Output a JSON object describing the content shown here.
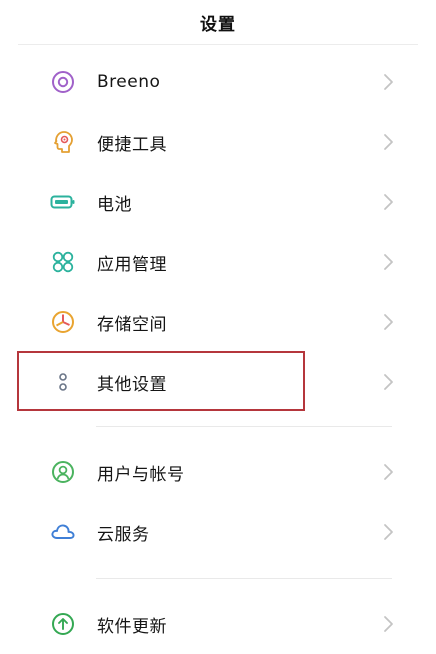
{
  "header": {
    "title": "设置"
  },
  "colors": {
    "highlight_border": "#b5363c",
    "breeno": "#a061c9",
    "shortcuts": "#e4a033",
    "battery": "#2bb29d",
    "apps": "#2bb29d",
    "storage": "#e9a430",
    "other": "#6a7587",
    "account": "#4bb35f",
    "cloud": "#3f7fd6",
    "update": "#34a853"
  },
  "settings": {
    "items": [
      {
        "label": "Breeno",
        "icon": "breeno-icon"
      },
      {
        "label": "便捷工具",
        "icon": "shortcut-tools-icon"
      },
      {
        "label": "电池",
        "icon": "battery-icon"
      },
      {
        "label": "应用管理",
        "icon": "app-management-icon"
      },
      {
        "label": "存储空间",
        "icon": "storage-icon"
      },
      {
        "label": "其他设置",
        "icon": "other-settings-icon",
        "highlighted": true
      },
      {
        "label": "用户与帐号",
        "icon": "user-account-icon"
      },
      {
        "label": "云服务",
        "icon": "cloud-icon"
      },
      {
        "label": "软件更新",
        "icon": "software-update-icon"
      }
    ]
  }
}
